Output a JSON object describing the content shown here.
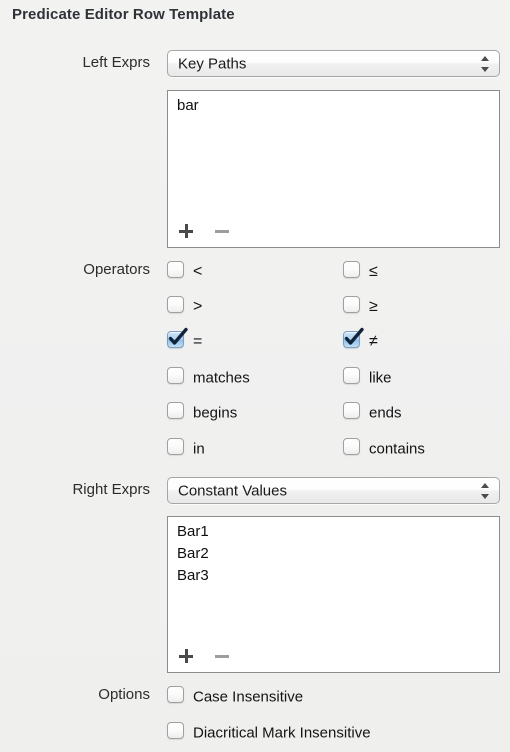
{
  "title": "Predicate Editor Row Template",
  "left_exprs": {
    "label": "Left Exprs",
    "popup_value": "Key Paths",
    "items": [
      "bar"
    ],
    "add_label": "+",
    "remove_label": "−"
  },
  "operators": {
    "label": "Operators",
    "rows": [
      {
        "left": {
          "label": "<",
          "checked": false
        },
        "right": {
          "label": "≤",
          "checked": false
        }
      },
      {
        "left": {
          "label": ">",
          "checked": false
        },
        "right": {
          "label": "≥",
          "checked": false
        }
      },
      {
        "left": {
          "label": "=",
          "checked": true
        },
        "right": {
          "label": "≠",
          "checked": true
        }
      },
      {
        "left": {
          "label": "matches",
          "checked": false
        },
        "right": {
          "label": "like",
          "checked": false
        }
      },
      {
        "left": {
          "label": "begins",
          "checked": false
        },
        "right": {
          "label": "ends",
          "checked": false
        }
      },
      {
        "left": {
          "label": "in",
          "checked": false
        },
        "right": {
          "label": "contains",
          "checked": false
        }
      }
    ]
  },
  "right_exprs": {
    "label": "Right Exprs",
    "popup_value": "Constant Values",
    "items": [
      "Bar1",
      "Bar2",
      "Bar3"
    ],
    "add_label": "+",
    "remove_label": "−"
  },
  "options": {
    "label": "Options",
    "rows": [
      {
        "label": "Case Insensitive",
        "checked": false
      },
      {
        "label": "Diacritical Mark Insensitive",
        "checked": false
      }
    ]
  },
  "colors": {
    "background": "#f0f0ef",
    "checkbox_on": "#8fc2e8",
    "check_mark": "#12243a",
    "border": "#8c8c8c",
    "text": "#141414"
  }
}
